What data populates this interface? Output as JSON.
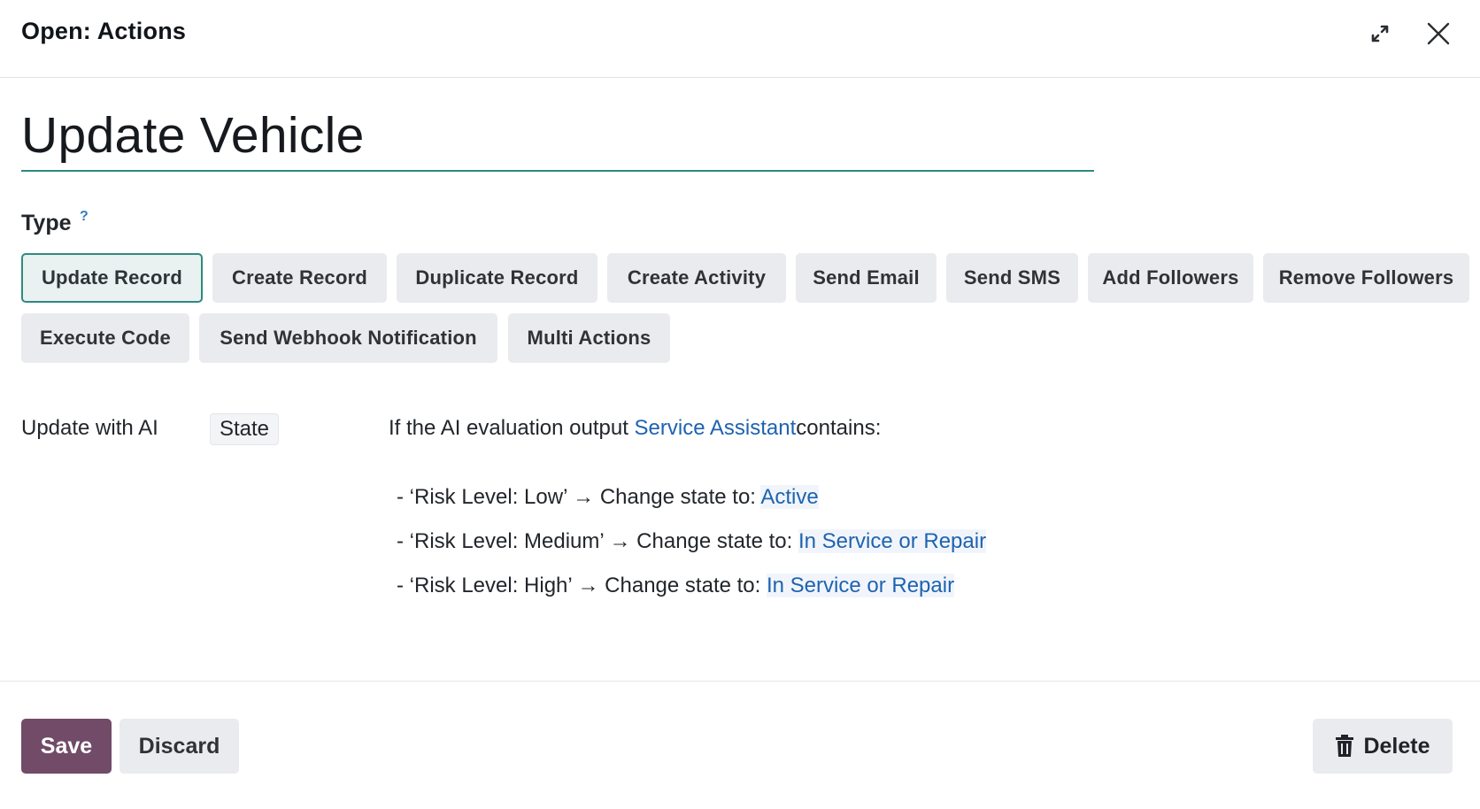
{
  "dialog": {
    "title": "Open: Actions",
    "expand_icon": "expand-icon",
    "close_icon": "close-icon"
  },
  "record": {
    "name": "Update Vehicle"
  },
  "type_field": {
    "label": "Type",
    "help": "?",
    "options": [
      {
        "label": "Update Record",
        "active": true
      },
      {
        "label": "Create Record",
        "active": false
      },
      {
        "label": "Duplicate Record",
        "active": false
      },
      {
        "label": "Create Activity",
        "active": false
      },
      {
        "label": "Send Email",
        "active": false
      },
      {
        "label": "Send SMS",
        "active": false
      },
      {
        "label": "Add Followers",
        "active": false
      },
      {
        "label": "Remove Followers",
        "active": false
      },
      {
        "label": "Execute Code",
        "active": false
      },
      {
        "label": "Send Webhook Notification",
        "active": false
      },
      {
        "label": "Multi Actions",
        "active": false
      }
    ]
  },
  "update_ai": {
    "label": "Update with AI",
    "field": "State",
    "intro_prefix": "If the AI evaluation output ",
    "intro_link": "Service Assistant",
    "intro_suffix": "contains:",
    "rules": [
      {
        "prefix": "- ‘Risk Level: Low’ ",
        "arrow": "→",
        "mid": " Change state to: ",
        "value": "Active"
      },
      {
        "prefix": "- ‘Risk Level: Medium’ ",
        "arrow": "→",
        "mid": " Change state to: ",
        "value": "In Service or Repair"
      },
      {
        "prefix": "- ‘Risk Level: High’ ",
        "arrow": "→",
        "mid": " Change state to: ",
        "value": "In Service or Repair"
      }
    ]
  },
  "footer": {
    "save_label": "Save",
    "discard_label": "Discard",
    "delete_label": "Delete",
    "delete_icon": "trash-icon"
  },
  "colors": {
    "primary": "#714b67",
    "accent_teal": "#2e8a80",
    "link": "#1e63b0"
  }
}
